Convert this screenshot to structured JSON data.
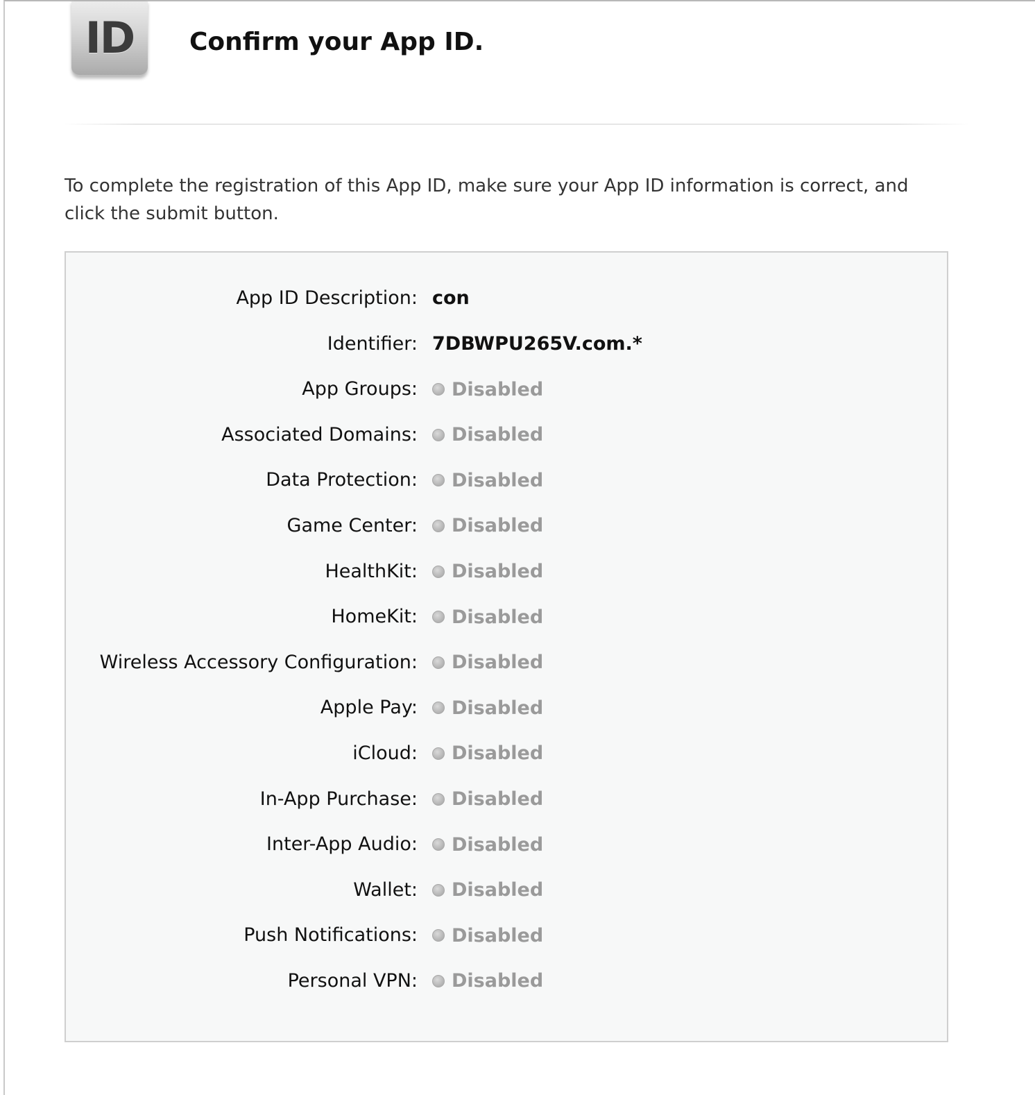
{
  "header": {
    "icon_label": "ID",
    "title": "Confirm your App ID."
  },
  "intro_text": "To complete the registration of this App ID, make sure your App ID information is correct, and click the submit button.",
  "details": {
    "description_label": "App ID Description:",
    "description_value": "con",
    "identifier_label": "Identifier:",
    "identifier_value": "7DBWPU265V.com.*"
  },
  "capabilities": [
    {
      "label": "App Groups:",
      "status": "Disabled"
    },
    {
      "label": "Associated Domains:",
      "status": "Disabled"
    },
    {
      "label": "Data Protection:",
      "status": "Disabled"
    },
    {
      "label": "Game Center:",
      "status": "Disabled"
    },
    {
      "label": "HealthKit:",
      "status": "Disabled"
    },
    {
      "label": "HomeKit:",
      "status": "Disabled"
    },
    {
      "label": "Wireless Accessory Configuration:",
      "status": "Disabled"
    },
    {
      "label": "Apple Pay:",
      "status": "Disabled"
    },
    {
      "label": "iCloud:",
      "status": "Disabled"
    },
    {
      "label": "In-App Purchase:",
      "status": "Disabled"
    },
    {
      "label": "Inter-App Audio:",
      "status": "Disabled"
    },
    {
      "label": "Wallet:",
      "status": "Disabled"
    },
    {
      "label": "Push Notifications:",
      "status": "Disabled"
    },
    {
      "label": "Personal VPN:",
      "status": "Disabled"
    }
  ],
  "colors": {
    "disabled_text": "#9a9a9a",
    "panel_background": "#f7f8f8",
    "panel_border": "#cfcfcf"
  }
}
